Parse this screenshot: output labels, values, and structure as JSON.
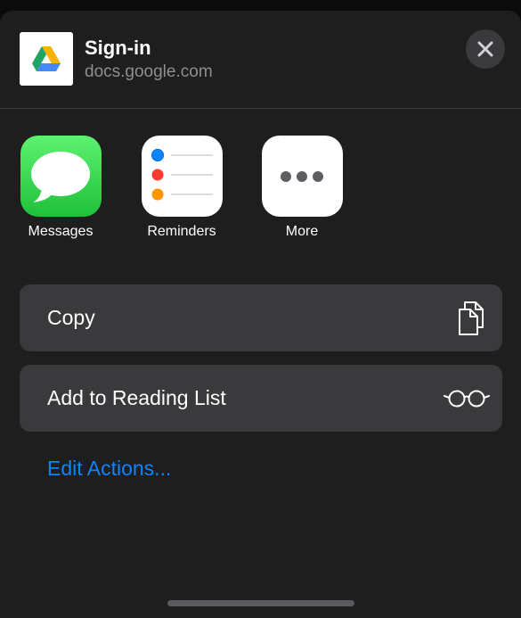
{
  "share_sheet": {
    "title": "Sign-in",
    "subtitle": "docs.google.com",
    "thumbnail_icon": "google-drive-logo",
    "close_icon": "close-icon"
  },
  "apps": [
    {
      "label": "Messages",
      "icon": "messages-icon",
      "color": "#34c759"
    },
    {
      "label": "Reminders",
      "icon": "reminders-icon",
      "color": "#ffffff"
    },
    {
      "label": "More",
      "icon": "more-icon",
      "color": "#ffffff"
    }
  ],
  "actions": [
    {
      "label": "Copy",
      "icon": "copy-icon"
    },
    {
      "label": "Add to Reading List",
      "icon": "glasses-icon"
    }
  ],
  "edit_actions_label": "Edit Actions...",
  "colors": {
    "background": "#1e1e1e",
    "row": "#3a3a3c",
    "accent": "#0a84ff",
    "secondary_text": "#8e8e93"
  }
}
